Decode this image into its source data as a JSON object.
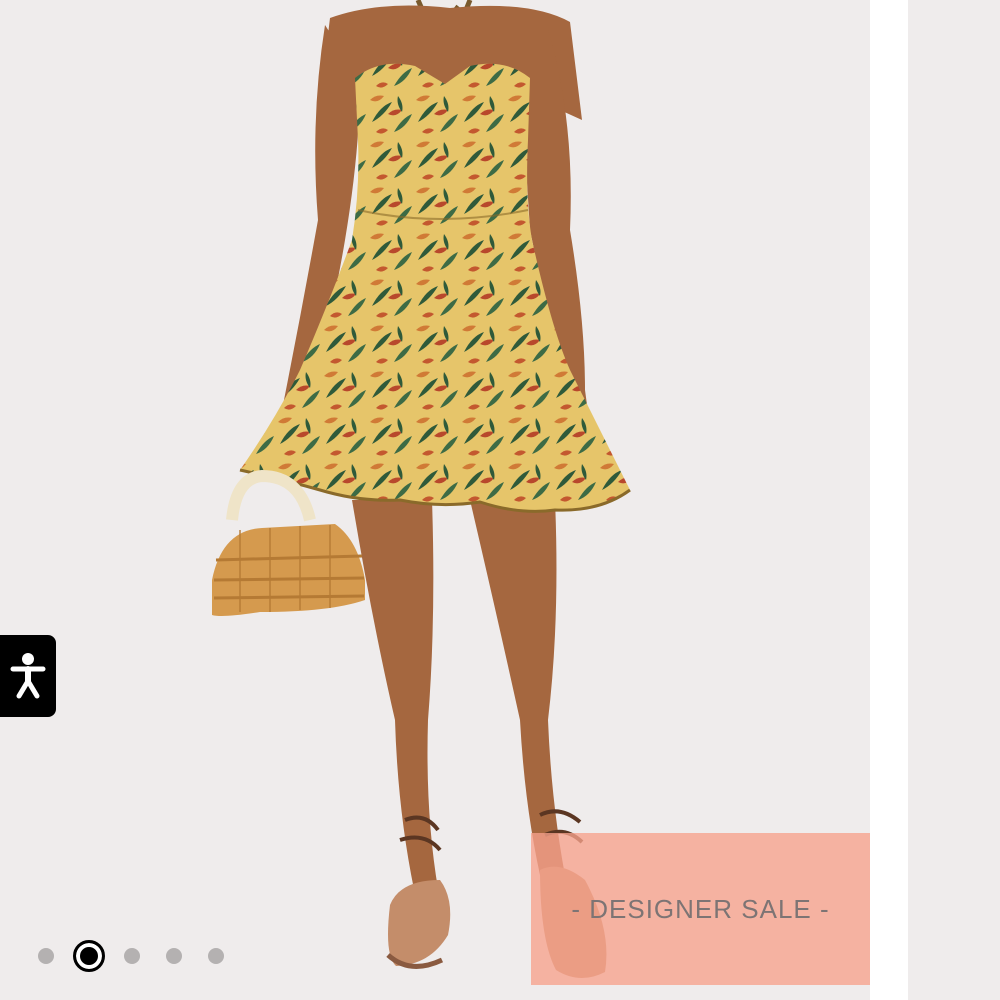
{
  "gallery": {
    "current_slide": 2,
    "total_slides": 5,
    "dots": [
      {
        "index": 1,
        "active": false
      },
      {
        "index": 2,
        "active": true
      },
      {
        "index": 3,
        "active": false
      },
      {
        "index": 4,
        "active": false
      },
      {
        "index": 5,
        "active": false
      }
    ]
  },
  "banner": {
    "text": "- DESIGNER SALE -",
    "color": "#f6a28c"
  },
  "accessibility": {
    "icon": "accessibility-person-icon"
  },
  "colors": {
    "photo_background": "#efecec",
    "skin": "#a5673f",
    "dress_base": "#e6c56a",
    "leaf_green": "#2f5a3a",
    "flower_red": "#b8482c",
    "bag": "#d59a4e"
  }
}
